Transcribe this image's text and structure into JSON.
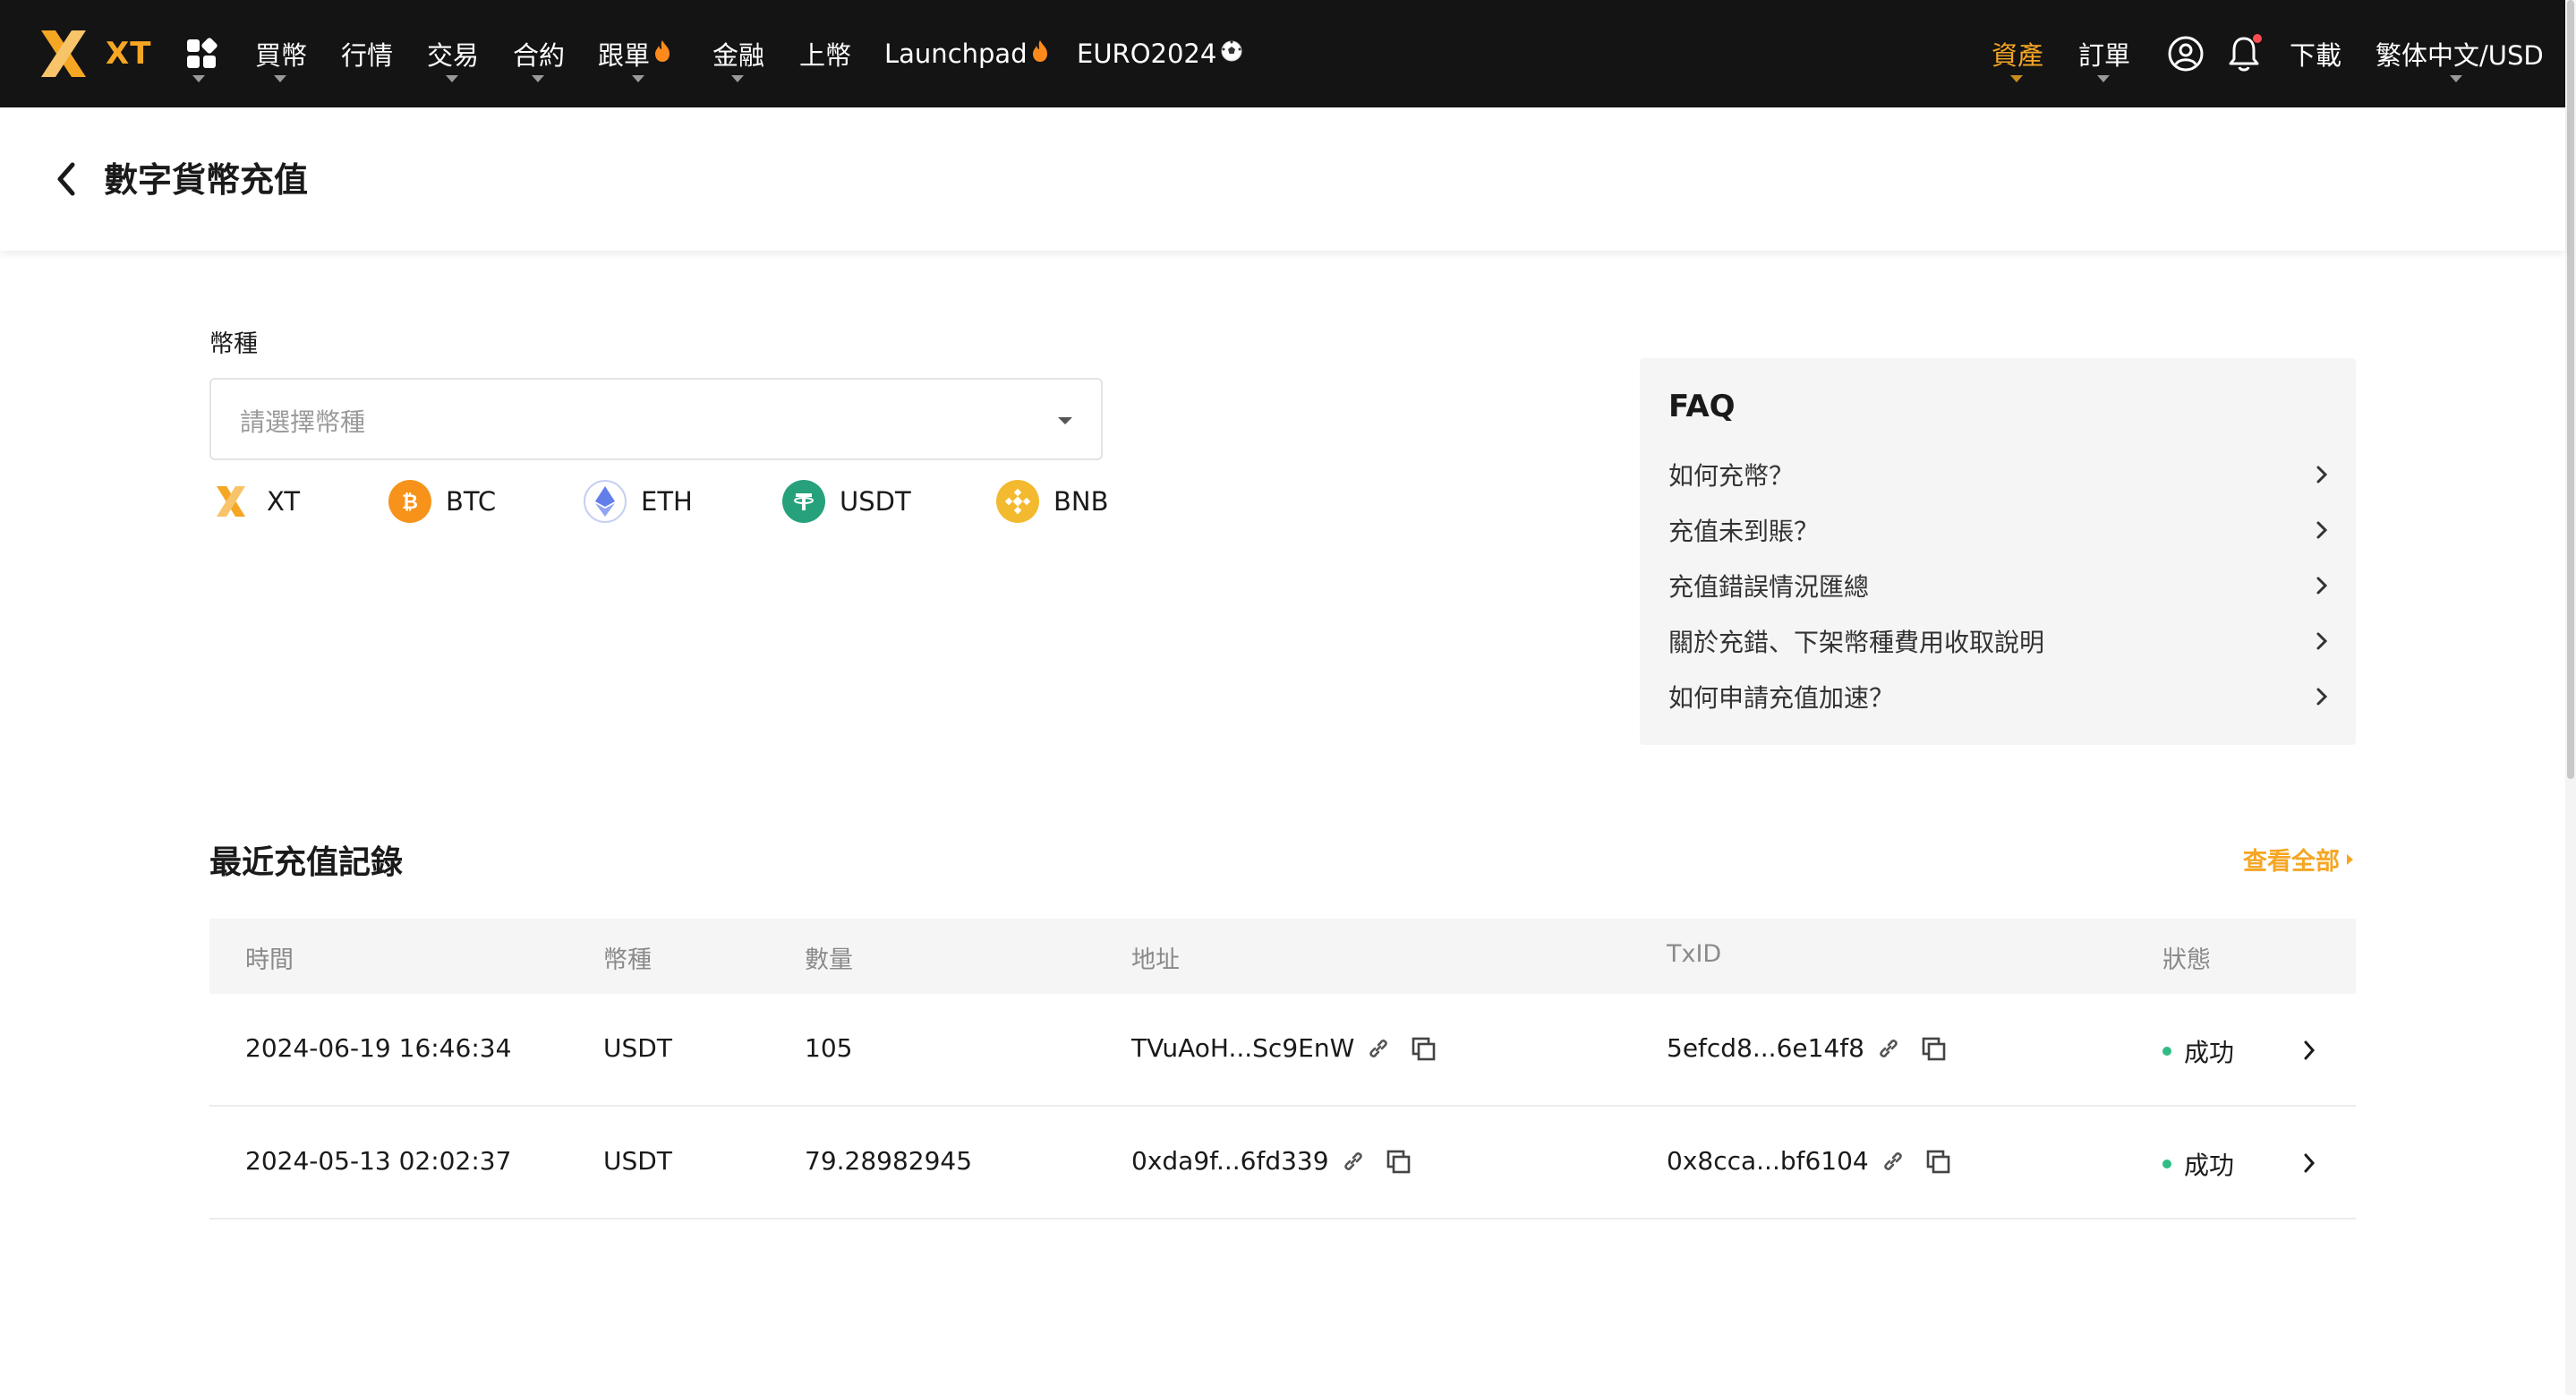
{
  "nav": {
    "logo_text": "XT",
    "items": [
      {
        "label": "買幣",
        "has_caret": true
      },
      {
        "label": "行情",
        "has_caret": false
      },
      {
        "label": "交易",
        "has_caret": true
      },
      {
        "label": "合約",
        "has_caret": true
      },
      {
        "label": "跟單",
        "has_caret": true,
        "badge": "flame-icon"
      },
      {
        "label": "金融",
        "has_caret": true
      },
      {
        "label": "上幣",
        "has_caret": false
      },
      {
        "label": "Launchpad",
        "has_caret": false,
        "badge": "flame-icon"
      },
      {
        "label": "EURO2024",
        "has_caret": false,
        "badge": "soccer-ball-icon"
      }
    ],
    "right": {
      "assets": "資產",
      "orders": "訂單",
      "download": "下載",
      "locale": "繁体中文/USD"
    },
    "colors": {
      "bar": "#141414",
      "accent": "#f5a623"
    }
  },
  "page": {
    "title": "數字貨幣充值"
  },
  "coin": {
    "label": "幣種",
    "placeholder": "請選擇幣種",
    "quick_coins": [
      {
        "symbol": "XT",
        "icon": "xt-coin-icon"
      },
      {
        "symbol": "BTC",
        "icon": "btc-coin-icon",
        "color": "#f7931a"
      },
      {
        "symbol": "ETH",
        "icon": "eth-coin-icon",
        "color": "#627eea"
      },
      {
        "symbol": "USDT",
        "icon": "usdt-coin-icon",
        "color": "#26a17b"
      },
      {
        "symbol": "BNB",
        "icon": "bnb-coin-icon",
        "color": "#f3ba2f"
      }
    ]
  },
  "faq": {
    "title": "FAQ",
    "items": [
      "如何充幣？",
      "充值未到賬？",
      "充值錯誤情況匯總",
      "關於充錯、下架幣種費用收取說明",
      "如何申請充值加速？"
    ]
  },
  "records": {
    "title": "最近充值記錄",
    "view_all": "查看全部",
    "columns": [
      "時間",
      "幣種",
      "數量",
      "地址",
      "TxID",
      "狀態"
    ],
    "rows": [
      {
        "time": "2024-06-19 16:46:34",
        "coin": "USDT",
        "amount": "105",
        "address": "TVuAoH...Sc9EnW",
        "txid": "5efcd8...6e14f8",
        "status": "成功"
      },
      {
        "time": "2024-05-13 02:02:37",
        "coin": "USDT",
        "amount": "79.28982945",
        "address": "0xda9f...6fd339",
        "txid": "0x8cca...bf6104",
        "status": "成功"
      }
    ],
    "status_color": "#2ebd85"
  }
}
